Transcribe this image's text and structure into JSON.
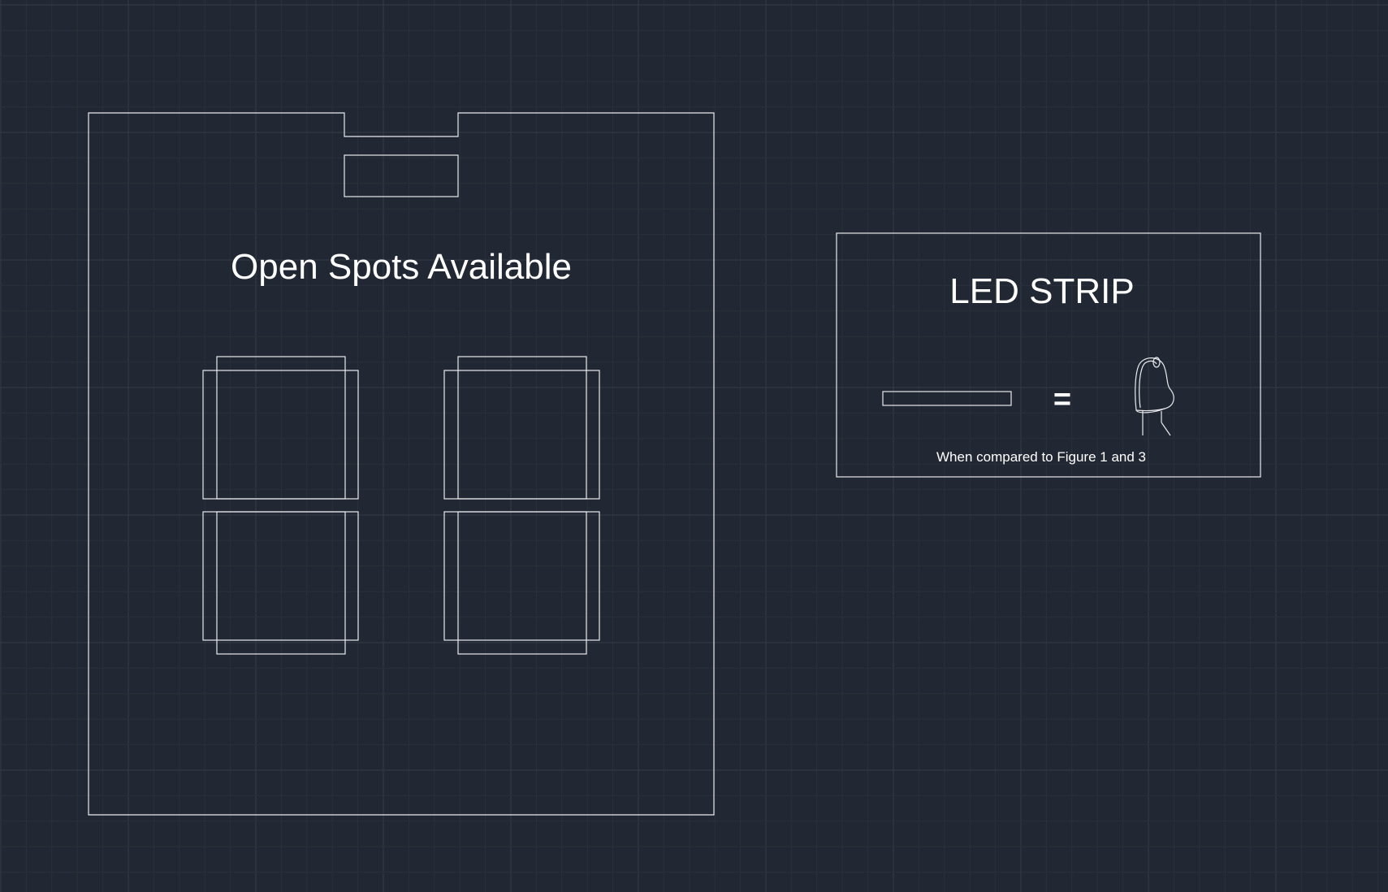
{
  "sign_panel": {
    "title": "Open Spots Available"
  },
  "led_legend": {
    "title": "LED STRIP",
    "equals_symbol": "=",
    "caption": "When compared to Figure 1 and 3"
  },
  "colors": {
    "background": "#222833",
    "grid_minor": "#2a303b",
    "grid_major": "#343b47",
    "linework": "#e8eaee"
  }
}
